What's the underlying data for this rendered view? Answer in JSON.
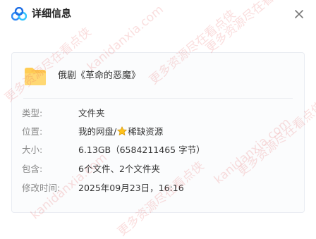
{
  "header": {
    "title": "详细信息",
    "logo_icon": "baidu-netdisk-logo",
    "close_icon": "close-icon"
  },
  "file": {
    "name": "俄剧《革命的恶魔》",
    "icon": "folder-icon",
    "icon_color": "#ffc94d"
  },
  "info": {
    "type_label": "类型:",
    "type_value": "文件夹",
    "location_label": "位置:",
    "location_part1": "我的网盘/",
    "location_part2": "稀缺资源",
    "size_label": "大小:",
    "size_value": "6.13GB（6584211465 字节）",
    "contains_label": "包含:",
    "contains_value": "6个文件、2个文件夹",
    "modified_label": "修改时间:",
    "modified_value": "2025年09月23日，16:16"
  },
  "watermark": {
    "text1": "kanidanxia.com",
    "text2": "更多资源尽在看点侠"
  }
}
